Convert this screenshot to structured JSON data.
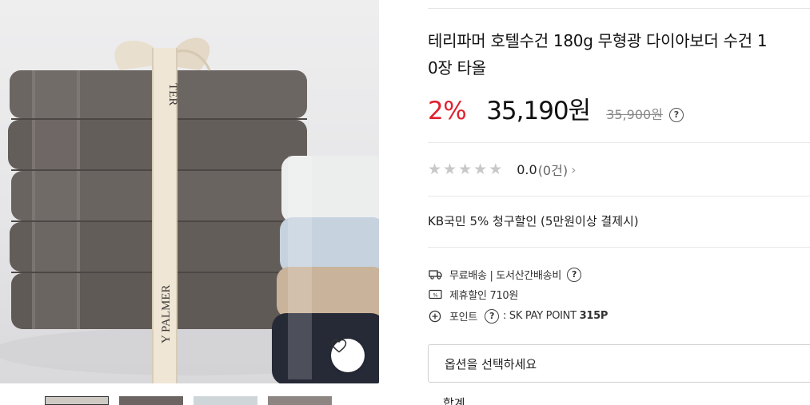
{
  "product": {
    "title_line1": "테리파머 호텔수건 180g 무형광 다이아보더 수건 1",
    "title_line2": "0장 타올",
    "discount": "2%",
    "sale_price": "35,190원",
    "original_price": "35,900원",
    "price_help": "?"
  },
  "image": {
    "band_text_top": "TER",
    "band_text_bottom": "Y PALMER",
    "band_text_mirror": "PALMER"
  },
  "rating": {
    "stars_filled": 0,
    "stars_total": 5,
    "value": "0.0",
    "count": "(0건)",
    "chevron": "›"
  },
  "benefit": {
    "card": "KB국민 5% 청구할인 (5만원이상 결제시)"
  },
  "shipping": {
    "label": "무료배송 | 도서산간배송비",
    "help": "?",
    "coupon": "제휴할인 710원",
    "point_label": "포인트",
    "point_help": "?",
    "point_prefix": ": SK PAY POINT",
    "point_value": "315P"
  },
  "option": {
    "placeholder": "옵션을 선택하세요"
  },
  "total": {
    "label": "합계"
  },
  "colors": {
    "accent_red": "#e02030",
    "towel_gray": "#6a6461",
    "towel_white": "#eceeee",
    "towel_blue": "#c6d2de",
    "towel_beige": "#c9b39a",
    "towel_navy": "#262a36"
  }
}
